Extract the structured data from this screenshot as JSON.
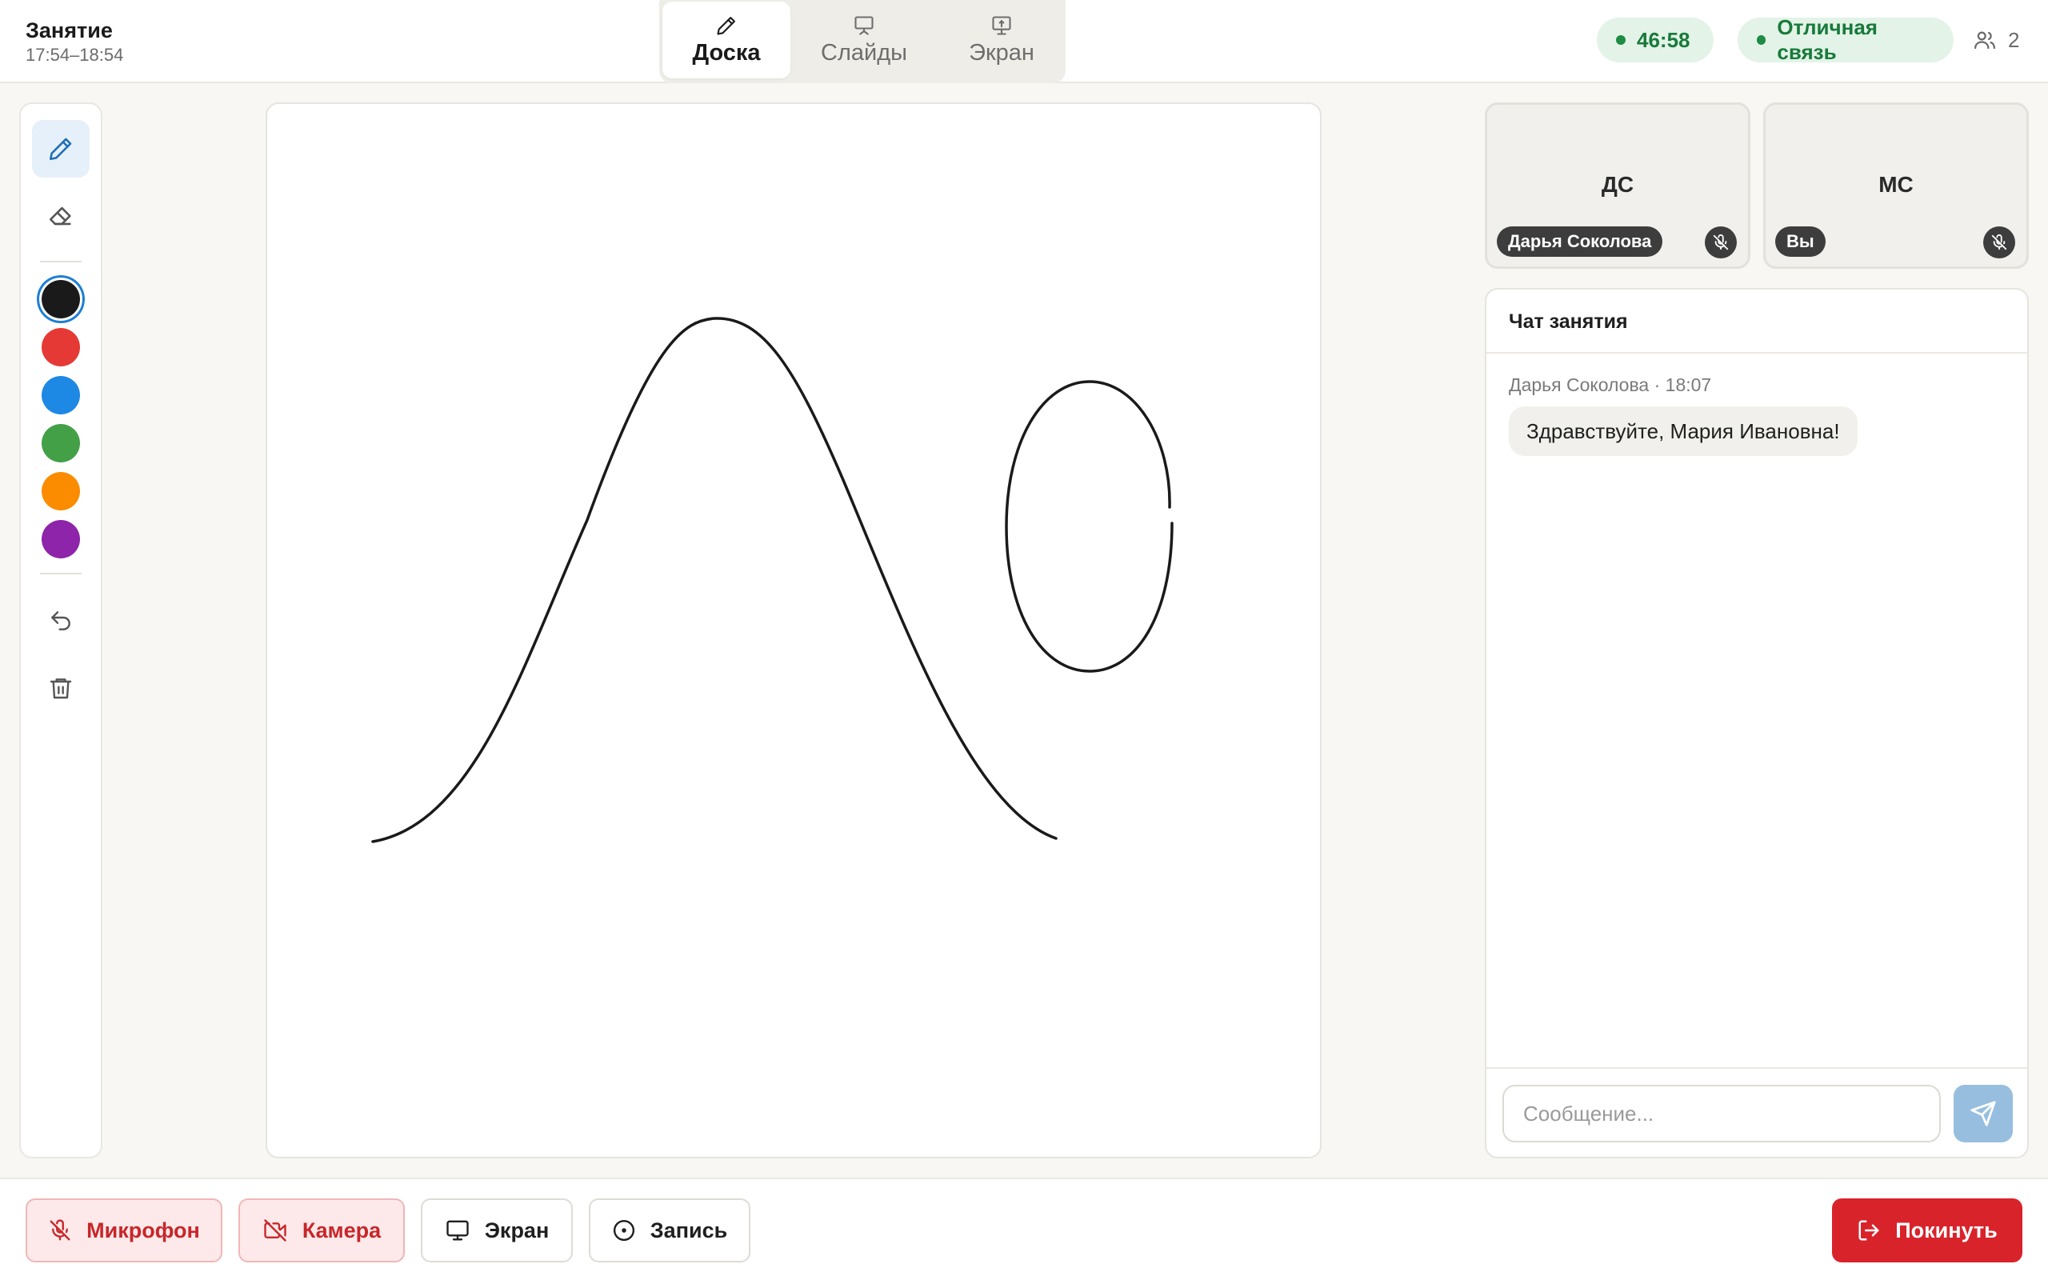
{
  "header": {
    "title": "Занятие",
    "time_range": "17:54–18:54",
    "tabs": [
      {
        "label": "Доска",
        "icon": "pencil-icon",
        "active": true
      },
      {
        "label": "Слайды",
        "icon": "presentation-icon",
        "active": false
      },
      {
        "label": "Экран",
        "icon": "screen-share-icon",
        "active": false
      }
    ],
    "timer": "46:58",
    "connection": "Отличная связь",
    "participants_count": "2"
  },
  "toolbar": {
    "tools": [
      {
        "name": "pencil",
        "icon": "pencil-icon",
        "active": true
      },
      {
        "name": "eraser",
        "icon": "eraser-icon",
        "active": false
      }
    ],
    "colors": [
      "#1a1a1a",
      "#e53935",
      "#1e88e5",
      "#43a047",
      "#fb8c00",
      "#8e24aa"
    ],
    "selected_color": "#1a1a1a",
    "actions": [
      {
        "name": "undo",
        "icon": "undo-icon"
      },
      {
        "name": "clear",
        "icon": "trash-icon"
      }
    ]
  },
  "whiteboard": {
    "stroke_color": "#1a1a1a",
    "shapes": [
      "bell-curve-stroke",
      "ellipse-stroke"
    ]
  },
  "videos": [
    {
      "initials": "ДС",
      "name": "Дарья Соколова",
      "muted": true
    },
    {
      "initials": "МС",
      "name": "Вы",
      "muted": true
    }
  ],
  "chat": {
    "title": "Чат занятия",
    "messages": [
      {
        "meta": "Дарья Соколова · 18:07",
        "text": "Здравствуйте, Мария Ивановна!"
      }
    ],
    "input_placeholder": "Сообщение...",
    "input_value": ""
  },
  "controls": {
    "mic_label": "Микрофон",
    "camera_label": "Камера",
    "screen_label": "Экран",
    "record_label": "Запись",
    "leave_label": "Покинуть"
  },
  "colors": {
    "accent_blue": "#1e7fd4",
    "success_green": "#177a3a",
    "danger_red": "#d9232a"
  }
}
